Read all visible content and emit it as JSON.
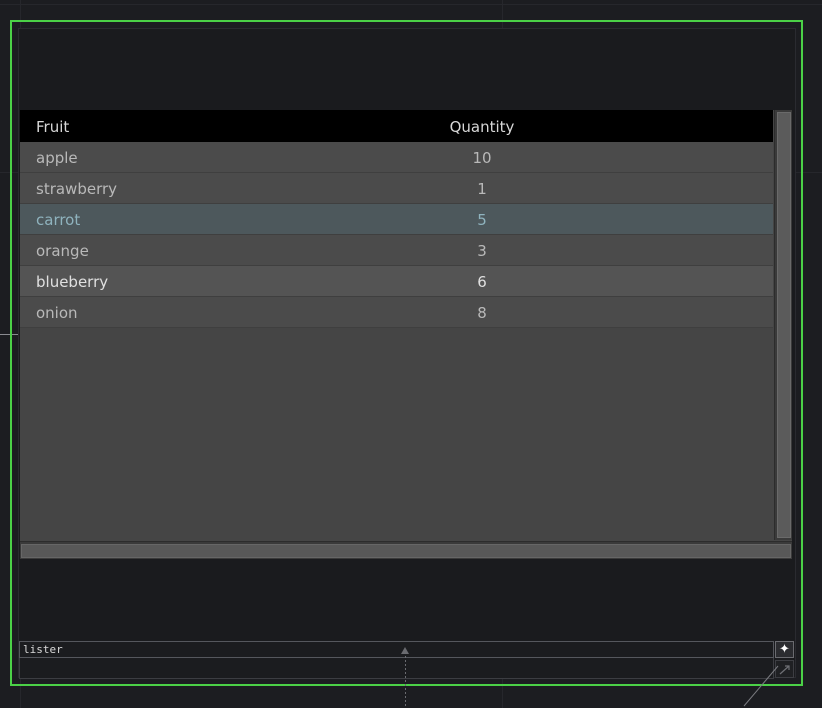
{
  "table": {
    "headers": {
      "fruit": "Fruit",
      "quantity": "Quantity"
    },
    "rows": [
      {
        "fruit": "apple",
        "quantity": "10",
        "state": "normal"
      },
      {
        "fruit": "strawberry",
        "quantity": "1",
        "state": "normal"
      },
      {
        "fruit": "carrot",
        "quantity": "5",
        "state": "selected"
      },
      {
        "fruit": "orange",
        "quantity": "3",
        "state": "normal"
      },
      {
        "fruit": "blueberry",
        "quantity": "6",
        "state": "hover"
      },
      {
        "fruit": "onion",
        "quantity": "8",
        "state": "normal"
      }
    ]
  },
  "node": {
    "name": "lister"
  },
  "colors": {
    "selection_frame": "#4bd147",
    "header_bg": "#000000",
    "row_bg": "#4b4b4b",
    "row_selected_bg": "#4d585c",
    "row_selected_text": "#8fb3be",
    "row_hover_bg": "#545454",
    "row_hover_text": "#e0e0e0"
  },
  "icons": {
    "viewer_toggle": "plus-sparkle-icon",
    "corner": "resize-arrow-icon"
  }
}
